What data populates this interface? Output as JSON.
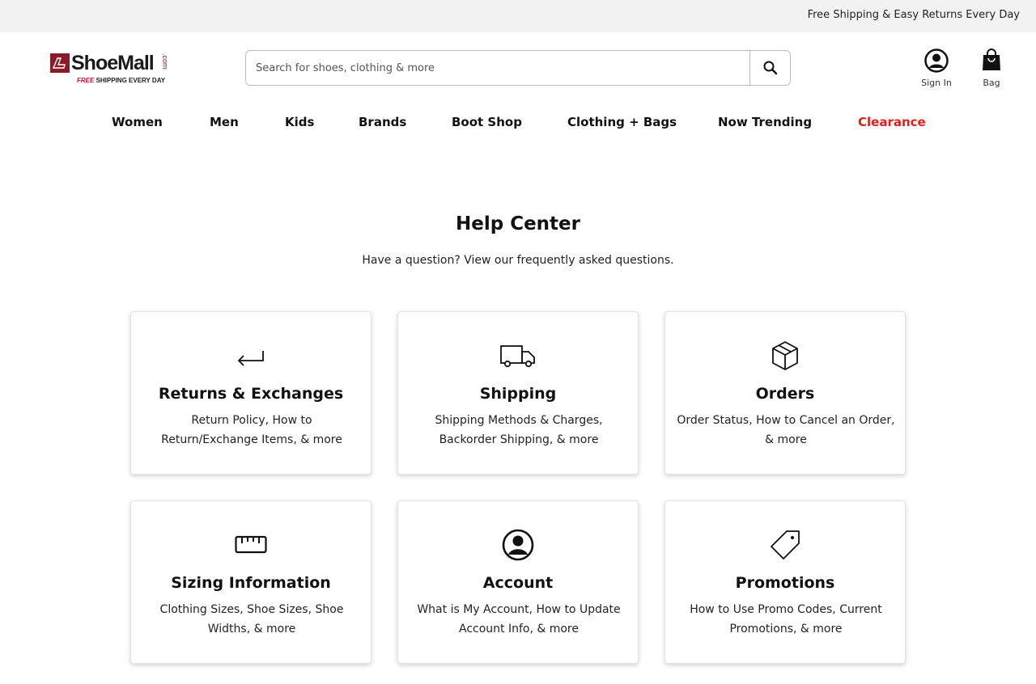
{
  "promo_bar": {
    "text": "Free Shipping & Easy Returns Every Day"
  },
  "logo": {
    "name": "ShoeMall",
    "suffix": ".com",
    "tag_free": "FREE",
    "tag_rest": " SHIPPING EVERY DAY"
  },
  "search": {
    "placeholder": "Search for shoes, clothing & more",
    "value": ""
  },
  "utility": {
    "sign_in": "Sign In",
    "bag": "Bag"
  },
  "nav": {
    "women": "Women",
    "men": "Men",
    "kids": "Kids",
    "brands": "Brands",
    "boot_shop": "Boot Shop",
    "clothing_bags": "Clothing + Bags",
    "now_trending": "Now Trending",
    "clearance": "Clearance"
  },
  "help": {
    "title": "Help Center",
    "subtitle": "Have a question? View our frequently asked questions.",
    "cards": [
      {
        "icon": "return-arrow-icon",
        "title": "Returns & Exchanges",
        "desc": "Return Policy, How to Return/Exchange Items, & more"
      },
      {
        "icon": "truck-icon",
        "title": "Shipping",
        "desc": "Shipping Methods & Charges, Backorder Shipping, & more"
      },
      {
        "icon": "box-icon",
        "title": "Orders",
        "desc": "Order Status, How to Cancel an Order, & more"
      },
      {
        "icon": "ruler-icon",
        "title": "Sizing Information",
        "desc": "Clothing Sizes, Shoe Sizes, Shoe Widths, & more"
      },
      {
        "icon": "user-circle-icon",
        "title": "Account",
        "desc": "What is My Account, How to Update Account Info, & more"
      },
      {
        "icon": "tag-icon",
        "title": "Promotions",
        "desc": "How to Use Promo Codes, Current Promotions, & more"
      }
    ]
  },
  "colors": {
    "brand": "#8b1a2b",
    "clearance": "#e0201f",
    "promo_bar_bg": "#f2f2f2"
  }
}
